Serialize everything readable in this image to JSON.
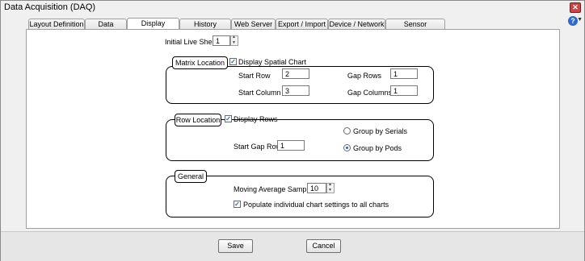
{
  "window": {
    "title": "Data Acquisition (DAQ)"
  },
  "tabs": [
    {
      "label": "Layout Definition"
    },
    {
      "label": "Data Source"
    },
    {
      "label": "Display Options"
    },
    {
      "label": "History Logging"
    },
    {
      "label": "Web Server"
    },
    {
      "label": "Export / Import"
    },
    {
      "label": "Device / Network"
    },
    {
      "label": "Sensor Information"
    }
  ],
  "active_tab": "Display Options",
  "initial_live_sheet": {
    "label": "Initial Live Sheet:",
    "value": "1"
  },
  "matrix_location": {
    "title": "Matrix Location",
    "display_spatial_chart": {
      "label": "Display Spatial Chart",
      "checked": true
    },
    "start_row": {
      "label": "Start Row",
      "value": "2"
    },
    "start_column": {
      "label": "Start Column",
      "value": "3"
    },
    "gap_rows": {
      "label": "Gap Rows",
      "value": "1"
    },
    "gap_columns": {
      "label": "Gap Columns",
      "value": "1"
    }
  },
  "row_location": {
    "title": "Row Location",
    "display_rows": {
      "label": "Display Rows",
      "checked": true
    },
    "start_gap_rows": {
      "label": "Start Gap Rows",
      "value": "1"
    },
    "group_by_serials": {
      "label": "Group by Serials",
      "selected": false
    },
    "group_by_pods": {
      "label": "Group by Pods",
      "selected": true
    }
  },
  "general": {
    "title": "General",
    "moving_average_samples": {
      "label": "Moving Average Samples",
      "value": "10"
    },
    "populate": {
      "label": "Populate individual chart settings to all charts",
      "checked": true
    }
  },
  "buttons": {
    "save": "Save",
    "cancel": "Cancel"
  }
}
